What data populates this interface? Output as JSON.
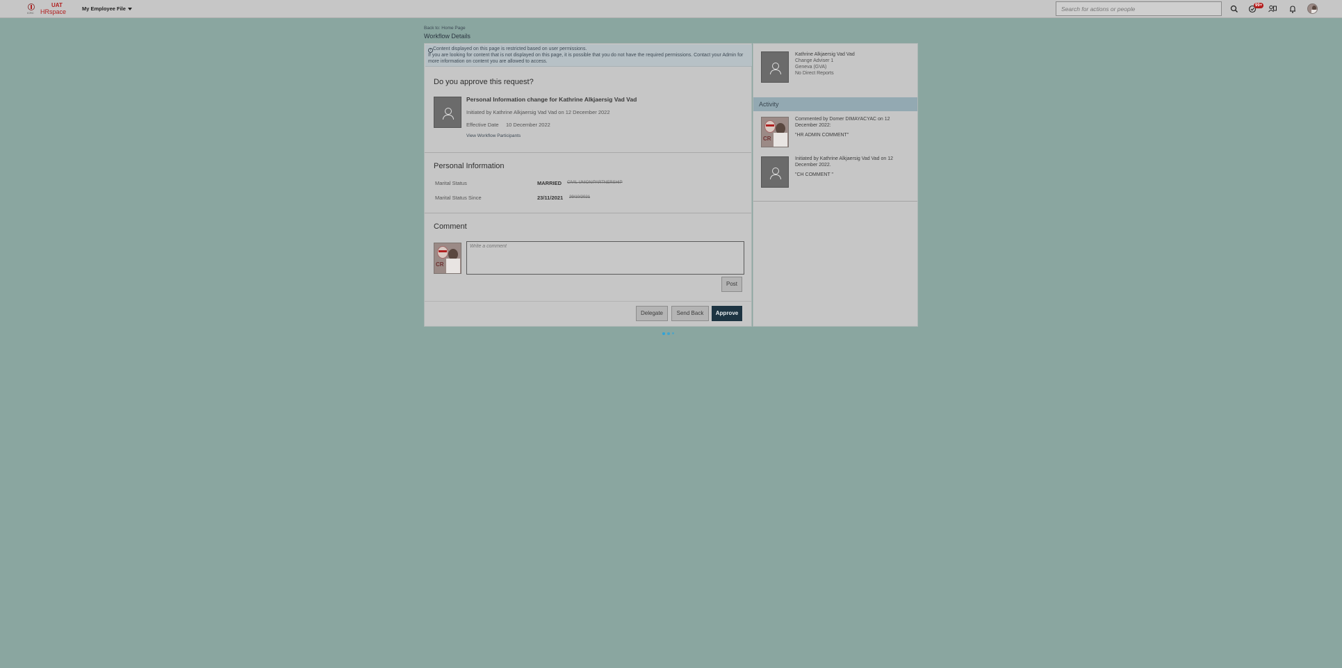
{
  "header": {
    "logo_top": "UAT",
    "logo_bottom": "HRspace",
    "logo_small": "ICRC",
    "menu_label": "My Employee File",
    "search_placeholder": "Search for actions or people",
    "notification_badge": "99+"
  },
  "page": {
    "back_link": "Back to: Home Page",
    "title": "Workflow Details"
  },
  "notice": {
    "line1": "Content displayed on this page is restricted based on user permissions.",
    "line2": "If you are looking for content that is not displayed on this page, it is possible that you do not have the required permissions. Contact your Admin for more information on content you are allowed to access."
  },
  "request": {
    "heading": "Do you approve this request?",
    "title": "Personal Information change for Kathrine Alkjaersig Vad Vad",
    "initiated": "Initiated by Kathrine Alkjaersig Vad Vad on 12 December 2022",
    "effective_label": "Effective Date",
    "effective_value": "10 December 2022",
    "participants_link": "View Workflow Participants"
  },
  "personal_info": {
    "heading": "Personal Information",
    "rows": [
      {
        "label": "Marital Status",
        "new": "MARRIED",
        "old": "CIVIL UNION/PARTNERSHIP"
      },
      {
        "label": "Marital Status Since",
        "new": "23/11/2021",
        "old": "29/10/2021"
      }
    ]
  },
  "comment": {
    "heading": "Comment",
    "placeholder": "Write a comment",
    "post_label": "Post"
  },
  "actions": {
    "delegate": "Delegate",
    "send_back": "Send Back",
    "approve": "Approve"
  },
  "profile": {
    "name": "Kathrine Alkjaersig Vad Vad",
    "role": "Change Adviser 1",
    "location": "Geneva (GVA)",
    "reports": "No Direct Reports"
  },
  "activity": {
    "heading": "Activity",
    "items": [
      {
        "text": "Commented by Domer DIMAYACYAC on 12 December 2022:",
        "quote": "\"HR ADMIN COMMENT\""
      },
      {
        "text": "Initiated by Kathrine Alkjaersig Vad Vad on 12 December 2022.",
        "quote": "\"CH COMMENT \""
      }
    ]
  },
  "colors": {
    "overlay_bg": "#8aa6a0",
    "primary_button": "#1d3442",
    "badge": "#b31b1b",
    "loader": "#2fa3d8"
  }
}
